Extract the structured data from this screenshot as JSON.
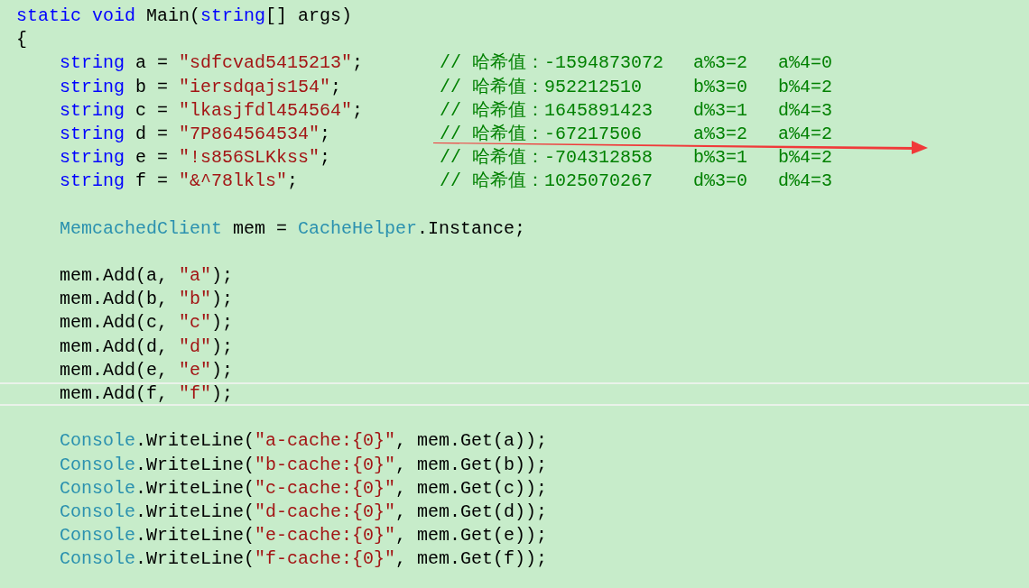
{
  "code": {
    "signature": [
      {
        "kind": "keyword",
        "text": "static void "
      },
      {
        "kind": "plain",
        "text": "Main("
      },
      {
        "kind": "keyword",
        "text": "string"
      },
      {
        "kind": "plain",
        "text": "[] args)"
      }
    ],
    "open_brace": "{",
    "body": [
      {
        "kind": "code",
        "current": false,
        "tokens": [
          {
            "kind": "keyword",
            "text": "string"
          },
          {
            "kind": "plain",
            "text": " a = "
          },
          {
            "kind": "string",
            "text": "\"sdfcvad5415213\""
          },
          {
            "kind": "plain",
            "text": ";"
          }
        ],
        "comment": {
          "hash": "// 哈希值：-1594873072",
          "mod3": "a%3=2",
          "mod4": "a%4=0"
        }
      },
      {
        "kind": "code",
        "current": false,
        "tokens": [
          {
            "kind": "keyword",
            "text": "string"
          },
          {
            "kind": "plain",
            "text": " b = "
          },
          {
            "kind": "string",
            "text": "\"iersdqajs154\""
          },
          {
            "kind": "plain",
            "text": ";"
          }
        ],
        "comment": {
          "hash": "// 哈希值：952212510",
          "mod3": "b%3=0",
          "mod4": "b%4=2"
        }
      },
      {
        "kind": "code",
        "current": false,
        "tokens": [
          {
            "kind": "keyword",
            "text": "string"
          },
          {
            "kind": "plain",
            "text": " c = "
          },
          {
            "kind": "string",
            "text": "\"lkasjfdl454564\""
          },
          {
            "kind": "plain",
            "text": ";"
          }
        ],
        "comment": {
          "hash": "// 哈希值：1645891423",
          "mod3": "d%3=1",
          "mod4": "d%4=3"
        }
      },
      {
        "kind": "code",
        "current": false,
        "tokens": [
          {
            "kind": "keyword",
            "text": "string"
          },
          {
            "kind": "plain",
            "text": " d = "
          },
          {
            "kind": "string",
            "text": "\"7P864564534\""
          },
          {
            "kind": "plain",
            "text": ";"
          }
        ],
        "comment": {
          "hash": "// 哈希值：-67217506",
          "mod3": "a%3=2",
          "mod4": "a%4=2"
        }
      },
      {
        "kind": "code",
        "current": false,
        "tokens": [
          {
            "kind": "keyword",
            "text": "string"
          },
          {
            "kind": "plain",
            "text": " e = "
          },
          {
            "kind": "string",
            "text": "\"!s856SLKkss\""
          },
          {
            "kind": "plain",
            "text": ";"
          }
        ],
        "comment": {
          "hash": "// 哈希值：-704312858",
          "mod3": "b%3=1",
          "mod4": "b%4=2"
        }
      },
      {
        "kind": "code",
        "current": false,
        "tokens": [
          {
            "kind": "keyword",
            "text": "string"
          },
          {
            "kind": "plain",
            "text": " f = "
          },
          {
            "kind": "string",
            "text": "\"&^78lkls\""
          },
          {
            "kind": "plain",
            "text": ";"
          }
        ],
        "comment": {
          "hash": "// 哈希值：1025070267",
          "mod3": "d%3=0",
          "mod4": "d%4=3"
        }
      },
      {
        "kind": "blank"
      },
      {
        "kind": "code",
        "current": false,
        "tokens": [
          {
            "kind": "type",
            "text": "MemcachedClient"
          },
          {
            "kind": "plain",
            "text": " mem = "
          },
          {
            "kind": "type",
            "text": "CacheHelper"
          },
          {
            "kind": "plain",
            "text": ".Instance;"
          }
        ]
      },
      {
        "kind": "blank"
      },
      {
        "kind": "code",
        "current": false,
        "tokens": [
          {
            "kind": "plain",
            "text": "mem.Add(a, "
          },
          {
            "kind": "string",
            "text": "\"a\""
          },
          {
            "kind": "plain",
            "text": ");"
          }
        ]
      },
      {
        "kind": "code",
        "current": false,
        "tokens": [
          {
            "kind": "plain",
            "text": "mem.Add(b, "
          },
          {
            "kind": "string",
            "text": "\"b\""
          },
          {
            "kind": "plain",
            "text": ");"
          }
        ]
      },
      {
        "kind": "code",
        "current": false,
        "tokens": [
          {
            "kind": "plain",
            "text": "mem.Add(c, "
          },
          {
            "kind": "string",
            "text": "\"c\""
          },
          {
            "kind": "plain",
            "text": ");"
          }
        ]
      },
      {
        "kind": "code",
        "current": false,
        "tokens": [
          {
            "kind": "plain",
            "text": "mem.Add(d, "
          },
          {
            "kind": "string",
            "text": "\"d\""
          },
          {
            "kind": "plain",
            "text": ");"
          }
        ]
      },
      {
        "kind": "code",
        "current": false,
        "tokens": [
          {
            "kind": "plain",
            "text": "mem.Add(e, "
          },
          {
            "kind": "string",
            "text": "\"e\""
          },
          {
            "kind": "plain",
            "text": ");"
          }
        ]
      },
      {
        "kind": "code",
        "current": true,
        "tokens": [
          {
            "kind": "plain",
            "text": "mem.Add(f, "
          },
          {
            "kind": "string",
            "text": "\"f\""
          },
          {
            "kind": "plain",
            "text": ");"
          }
        ]
      },
      {
        "kind": "blank"
      },
      {
        "kind": "code",
        "current": false,
        "tokens": [
          {
            "kind": "type",
            "text": "Console"
          },
          {
            "kind": "plain",
            "text": ".WriteLine("
          },
          {
            "kind": "string",
            "text": "\"a-cache:{0}\""
          },
          {
            "kind": "plain",
            "text": ", mem.Get(a));"
          }
        ]
      },
      {
        "kind": "code",
        "current": false,
        "tokens": [
          {
            "kind": "type",
            "text": "Console"
          },
          {
            "kind": "plain",
            "text": ".WriteLine("
          },
          {
            "kind": "string",
            "text": "\"b-cache:{0}\""
          },
          {
            "kind": "plain",
            "text": ", mem.Get(b));"
          }
        ]
      },
      {
        "kind": "code",
        "current": false,
        "tokens": [
          {
            "kind": "type",
            "text": "Console"
          },
          {
            "kind": "plain",
            "text": ".WriteLine("
          },
          {
            "kind": "string",
            "text": "\"c-cache:{0}\""
          },
          {
            "kind": "plain",
            "text": ", mem.Get(c));"
          }
        ]
      },
      {
        "kind": "code",
        "current": false,
        "tokens": [
          {
            "kind": "type",
            "text": "Console"
          },
          {
            "kind": "plain",
            "text": ".WriteLine("
          },
          {
            "kind": "string",
            "text": "\"d-cache:{0}\""
          },
          {
            "kind": "plain",
            "text": ", mem.Get(d));"
          }
        ]
      },
      {
        "kind": "code",
        "current": false,
        "tokens": [
          {
            "kind": "type",
            "text": "Console"
          },
          {
            "kind": "plain",
            "text": ".WriteLine("
          },
          {
            "kind": "string",
            "text": "\"e-cache:{0}\""
          },
          {
            "kind": "plain",
            "text": ", mem.Get(e));"
          }
        ]
      },
      {
        "kind": "code",
        "current": false,
        "tokens": [
          {
            "kind": "type",
            "text": "Console"
          },
          {
            "kind": "plain",
            "text": ".WriteLine("
          },
          {
            "kind": "string",
            "text": "\"f-cache:{0}\""
          },
          {
            "kind": "plain",
            "text": ", mem.Get(f));"
          }
        ]
      }
    ]
  }
}
